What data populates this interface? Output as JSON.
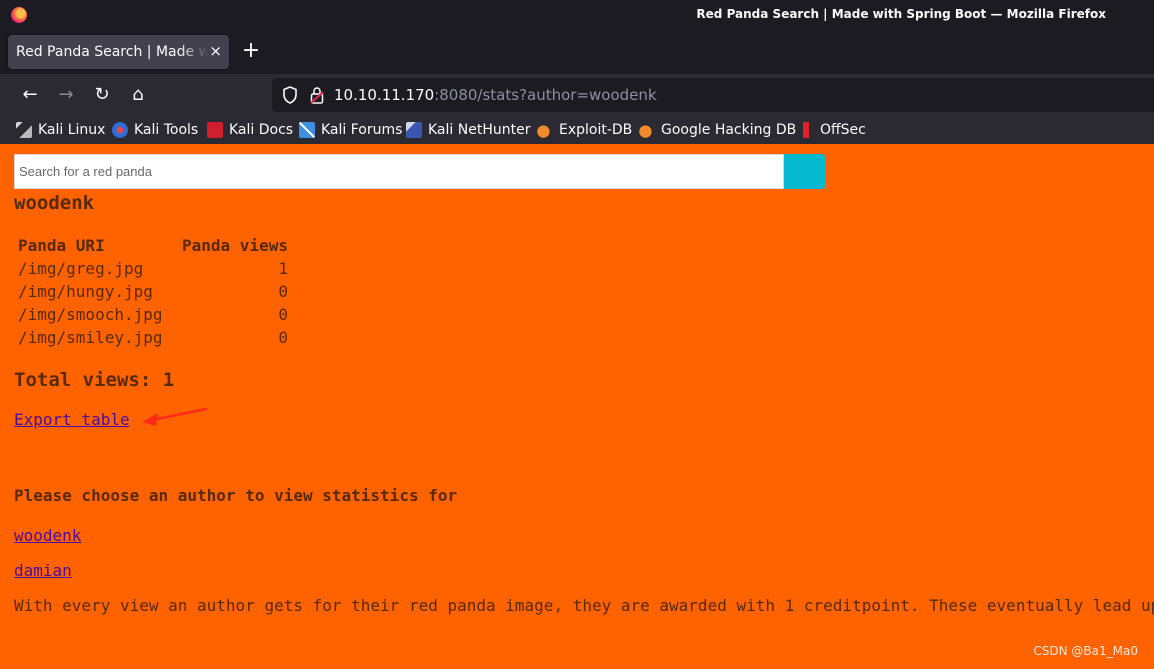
{
  "window": {
    "title": "Red Panda Search | Made with Spring Boot — Mozilla Firefox"
  },
  "tabs": [
    {
      "label": "Red Panda Search | Made with Spring Boot",
      "close": "×"
    }
  ],
  "new_tab": "+",
  "nav": {
    "back": "←",
    "forward": "→",
    "reload": "↻",
    "home": "⌂"
  },
  "url": {
    "host": "10.10.11.170",
    "rest": ":8080/stats?author=woodenk"
  },
  "bookmarks": [
    {
      "label": "Kali Linux",
      "icon": "kali-dragon-icon"
    },
    {
      "label": "Kali Tools",
      "icon": "kali-tools-icon"
    },
    {
      "label": "Kali Docs",
      "icon": "kali-docs-icon"
    },
    {
      "label": "Kali Forums",
      "icon": "kali-forums-icon"
    },
    {
      "label": "Kali NetHunter",
      "icon": "kali-nethunter-icon"
    },
    {
      "label": "Exploit-DB",
      "icon": "exploit-db-icon"
    },
    {
      "label": "Google Hacking DB",
      "icon": "ghdb-icon"
    },
    {
      "label": "OffSec",
      "icon": "offsec-icon"
    }
  ],
  "page": {
    "search_placeholder": "Search for a red panda",
    "author": "woodenk",
    "table": {
      "headers": [
        "Panda URI",
        "Panda views"
      ],
      "rows": [
        {
          "uri": "/img/greg.jpg",
          "views": "1"
        },
        {
          "uri": "/img/hungy.jpg",
          "views": "0"
        },
        {
          "uri": "/img/smooch.jpg",
          "views": "0"
        },
        {
          "uri": "/img/smiley.jpg",
          "views": "0"
        }
      ]
    },
    "total_views": "Total views: 1",
    "export_link": "Export table",
    "choose_heading": "Please choose an author to view statistics for",
    "authors": [
      "woodenk",
      "damian"
    ],
    "info_text": "With every view an author gets for their red panda image, they are awarded with 1 creditpoint. These eventually lead up to a bonus."
  },
  "watermark": "CSDN @Ba1_Ma0",
  "colors": {
    "page_bg": "#ff6300",
    "text": "#582a08",
    "link": "#4a0e9e",
    "search_button": "#05b8cf",
    "arrow": "#ff2a1a"
  }
}
